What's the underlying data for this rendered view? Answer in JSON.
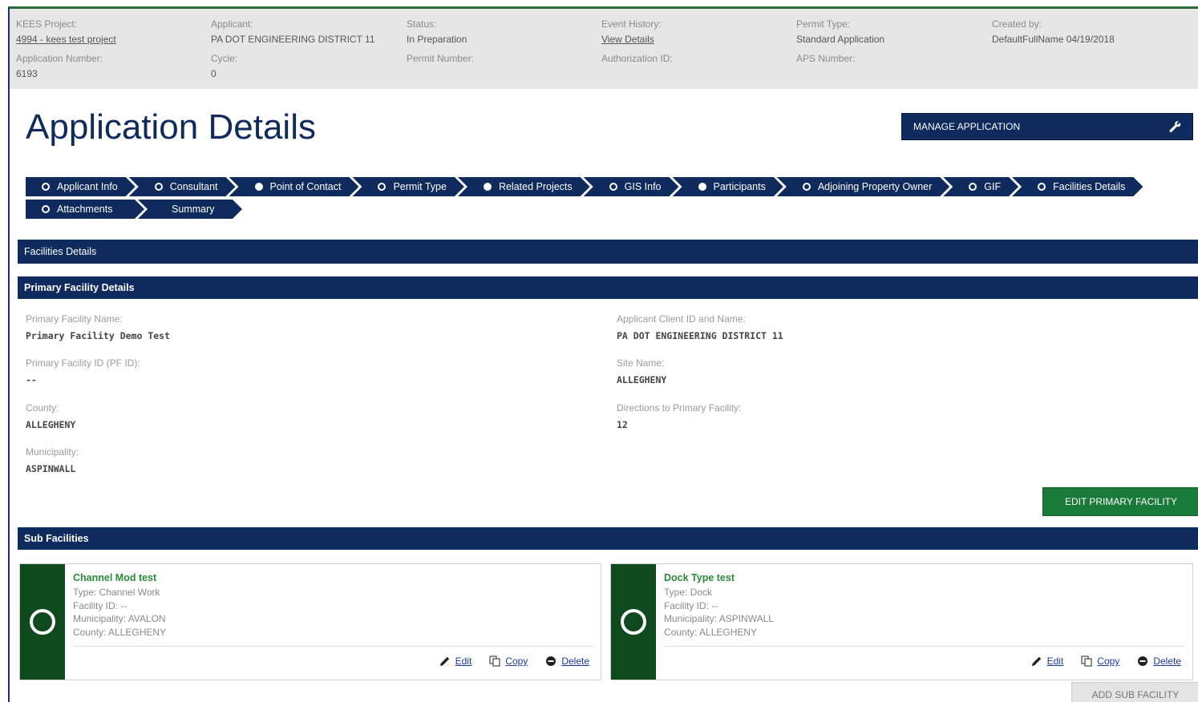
{
  "header": {
    "kees_project": {
      "label": "KEES Project:",
      "value": "4994 - kees test project"
    },
    "application_number": {
      "label": "Application Number:",
      "value": "6193"
    },
    "applicant": {
      "label": "Applicant:",
      "value": "PA DOT ENGINEERING DISTRICT 11"
    },
    "cycle": {
      "label": "Cycle:",
      "value": "0"
    },
    "status": {
      "label": "Status:",
      "value": "In Preparation"
    },
    "permit_number": {
      "label": "Permit Number:",
      "value": ""
    },
    "event_history": {
      "label": "Event History:",
      "value": "View Details"
    },
    "authorization_id": {
      "label": "Authorization ID:",
      "value": ""
    },
    "permit_type": {
      "label": "Permit Type:",
      "value": "Standard Application"
    },
    "aps_number": {
      "label": "APS Number:",
      "value": ""
    },
    "created_by": {
      "label": "Created by:",
      "value": "DefaultFullName 04/19/2018"
    }
  },
  "page": {
    "title": "Application Details",
    "manage_button": "MANAGE APPLICATION"
  },
  "steps": {
    "row1": [
      {
        "label": "Applicant Info",
        "filled": false
      },
      {
        "label": "Consultant",
        "filled": false
      },
      {
        "label": "Point of Contact",
        "filled": true
      },
      {
        "label": "Permit Type",
        "filled": false
      },
      {
        "label": "Related Projects",
        "filled": true
      },
      {
        "label": "GIS Info",
        "filled": false
      },
      {
        "label": "Participants",
        "filled": true
      },
      {
        "label": "Adjoining Property Owner",
        "filled": false
      },
      {
        "label": "GIF",
        "filled": false
      },
      {
        "label": "Facilities Details",
        "filled": false
      }
    ],
    "row2": [
      {
        "label": "Attachments",
        "filled": false
      },
      {
        "label": "Summary",
        "filled": null
      }
    ]
  },
  "sections": {
    "main": "Facilities Details",
    "primary": "Primary Facility Details",
    "sub": "Sub Facilities"
  },
  "primary_facility": {
    "name_label": "Primary Facility Name:",
    "name": "Primary Facility Demo Test",
    "pfid_label": "Primary Facility ID (PF ID):",
    "pfid": "--",
    "county_label": "County:",
    "county": "ALLEGHENY",
    "municipality_label": "Municipality:",
    "municipality": "ASPINWALL",
    "client_label": "Applicant Client ID and Name:",
    "client": "PA DOT ENGINEERING DISTRICT 11",
    "site_label": "Site Name:",
    "site": "ALLEGHENY",
    "directions_label": "Directions to Primary Facility:",
    "directions": "12",
    "edit_button": "EDIT PRIMARY FACILITY"
  },
  "sub_facilities": [
    {
      "title": "Channel Mod test",
      "type": "Type: Channel Work",
      "facility_id": "Facility ID: --",
      "municipality": "Municipality: AVALON",
      "county": "County: ALLEGHENY",
      "edit": "Edit",
      "copy": "Copy",
      "delete": "Delete"
    },
    {
      "title": "Dock Type test",
      "type": "Type: Dock",
      "facility_id": "Facility ID: --",
      "municipality": "Municipality: ASPINWALL",
      "county": "County: ALLEGHENY",
      "edit": "Edit",
      "copy": "Copy",
      "delete": "Delete"
    }
  ],
  "add_sub_button": "ADD SUB FACILITY",
  "colors": {
    "navy": "#0f2a5c",
    "green": "#1a7a3a",
    "dark_green": "#0e4a1e",
    "header_bg": "#e6e6e6"
  }
}
